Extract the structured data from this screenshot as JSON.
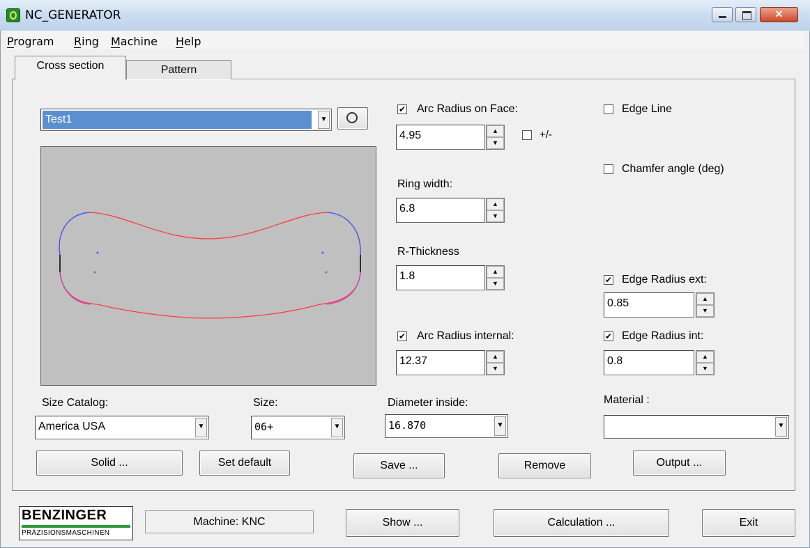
{
  "window": {
    "title": "NC_GENERATOR"
  },
  "menu": [
    "Program",
    "Ring",
    "Machine",
    "Help"
  ],
  "tabs": {
    "cross_section": "Cross section",
    "pattern": "Pattern"
  },
  "profile_select": {
    "value": "Test1"
  },
  "arc_radius_face": {
    "label": "Arc Radius on Face:",
    "checked": true,
    "value": "4.95",
    "plusminus_label": "+/-"
  },
  "edge_line": {
    "label": "Edge Line",
    "checked": false
  },
  "chamfer_angle": {
    "label": "Chamfer angle (deg)",
    "checked": false
  },
  "ring_width": {
    "label": "Ring width:",
    "value": "6.8"
  },
  "r_thickness": {
    "label": "R-Thickness",
    "value": "1.8"
  },
  "edge_radius_ext": {
    "label": "Edge Radius ext:",
    "checked": true,
    "value": "0.85"
  },
  "arc_radius_internal": {
    "label": "Arc Radius internal:",
    "checked": true,
    "value": "12.37"
  },
  "edge_radius_int": {
    "label": "Edge Radius int:",
    "checked": true,
    "value": "0.8"
  },
  "size_catalog": {
    "label": "Size Catalog:",
    "value": "America USA"
  },
  "size": {
    "label": "Size:",
    "value": "06+"
  },
  "diameter_inside": {
    "label": "Diameter inside:",
    "value": "16.870"
  },
  "material": {
    "label": "Material :",
    "value": ""
  },
  "buttons": {
    "solid": "Solid ...",
    "set_default": "Set default",
    "save": "Save ...",
    "remove": "Remove",
    "output": "Output ..."
  },
  "footer": {
    "logo_main": "BENZINGER",
    "logo_sub": "PRÄZISIONSMASCHINEN",
    "machine": "Machine: KNC",
    "show": "Show ...",
    "calculation": "Calculation ...",
    "exit": "Exit"
  },
  "colors": {
    "selection": "#5b8fd0",
    "profile_red": "#ff3b3b",
    "profile_blue": "#3b59ff",
    "preview_bg": "#c0c0c0"
  }
}
